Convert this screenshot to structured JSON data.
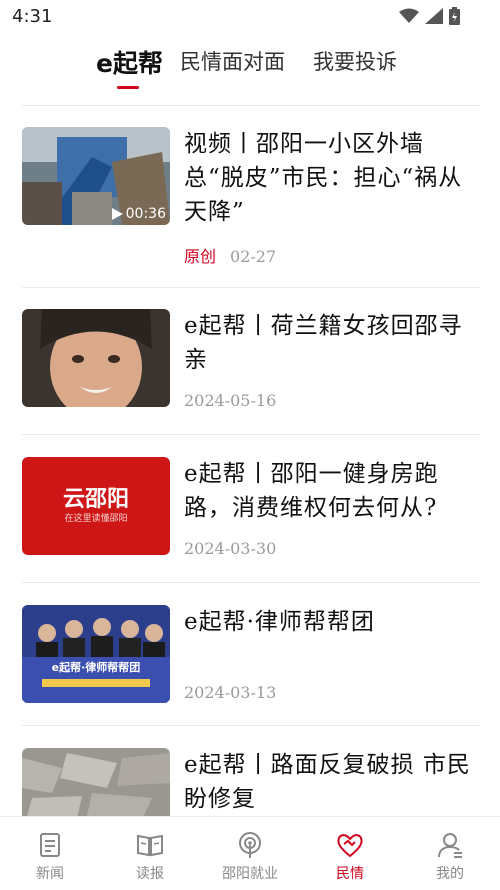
{
  "status_bar": {
    "time": "4:31"
  },
  "tabs": [
    {
      "label": "e起帮",
      "active": true
    },
    {
      "label": "民情面对面",
      "active": false
    },
    {
      "label": "我要投诉",
      "active": false
    }
  ],
  "news": [
    {
      "title": "视频丨邵阳一小区外墙总“脱皮”市民：担心“祸从天降”",
      "tag": "原创",
      "date": "02-27",
      "duration": "00:36"
    },
    {
      "title": "e起帮丨荷兰籍女孩回邵寻亲",
      "date": "2024-05-16"
    },
    {
      "title": "e起帮丨邵阳一健身房跑路，消费维权何去何从?",
      "date": "2024-03-30",
      "thumb_text": "云邵阳",
      "thumb_sub": "在这里读懂邵阳"
    },
    {
      "title": "e起帮·律师帮帮团",
      "date": "2024-03-13",
      "thumb_text": "e起帮·律师帮帮团"
    },
    {
      "title": "e起帮丨路面反复破损 市民盼修复"
    }
  ],
  "bottom_nav": [
    {
      "label": "新闻",
      "icon": "news-icon"
    },
    {
      "label": "读报",
      "icon": "book-icon"
    },
    {
      "label": "邵阳就业",
      "icon": "broadcast-icon"
    },
    {
      "label": "民情",
      "icon": "handshake-icon",
      "active": true
    },
    {
      "label": "我的",
      "icon": "user-icon"
    }
  ],
  "colors": {
    "accent": "#d0021b",
    "muted": "#9a9a9a"
  }
}
